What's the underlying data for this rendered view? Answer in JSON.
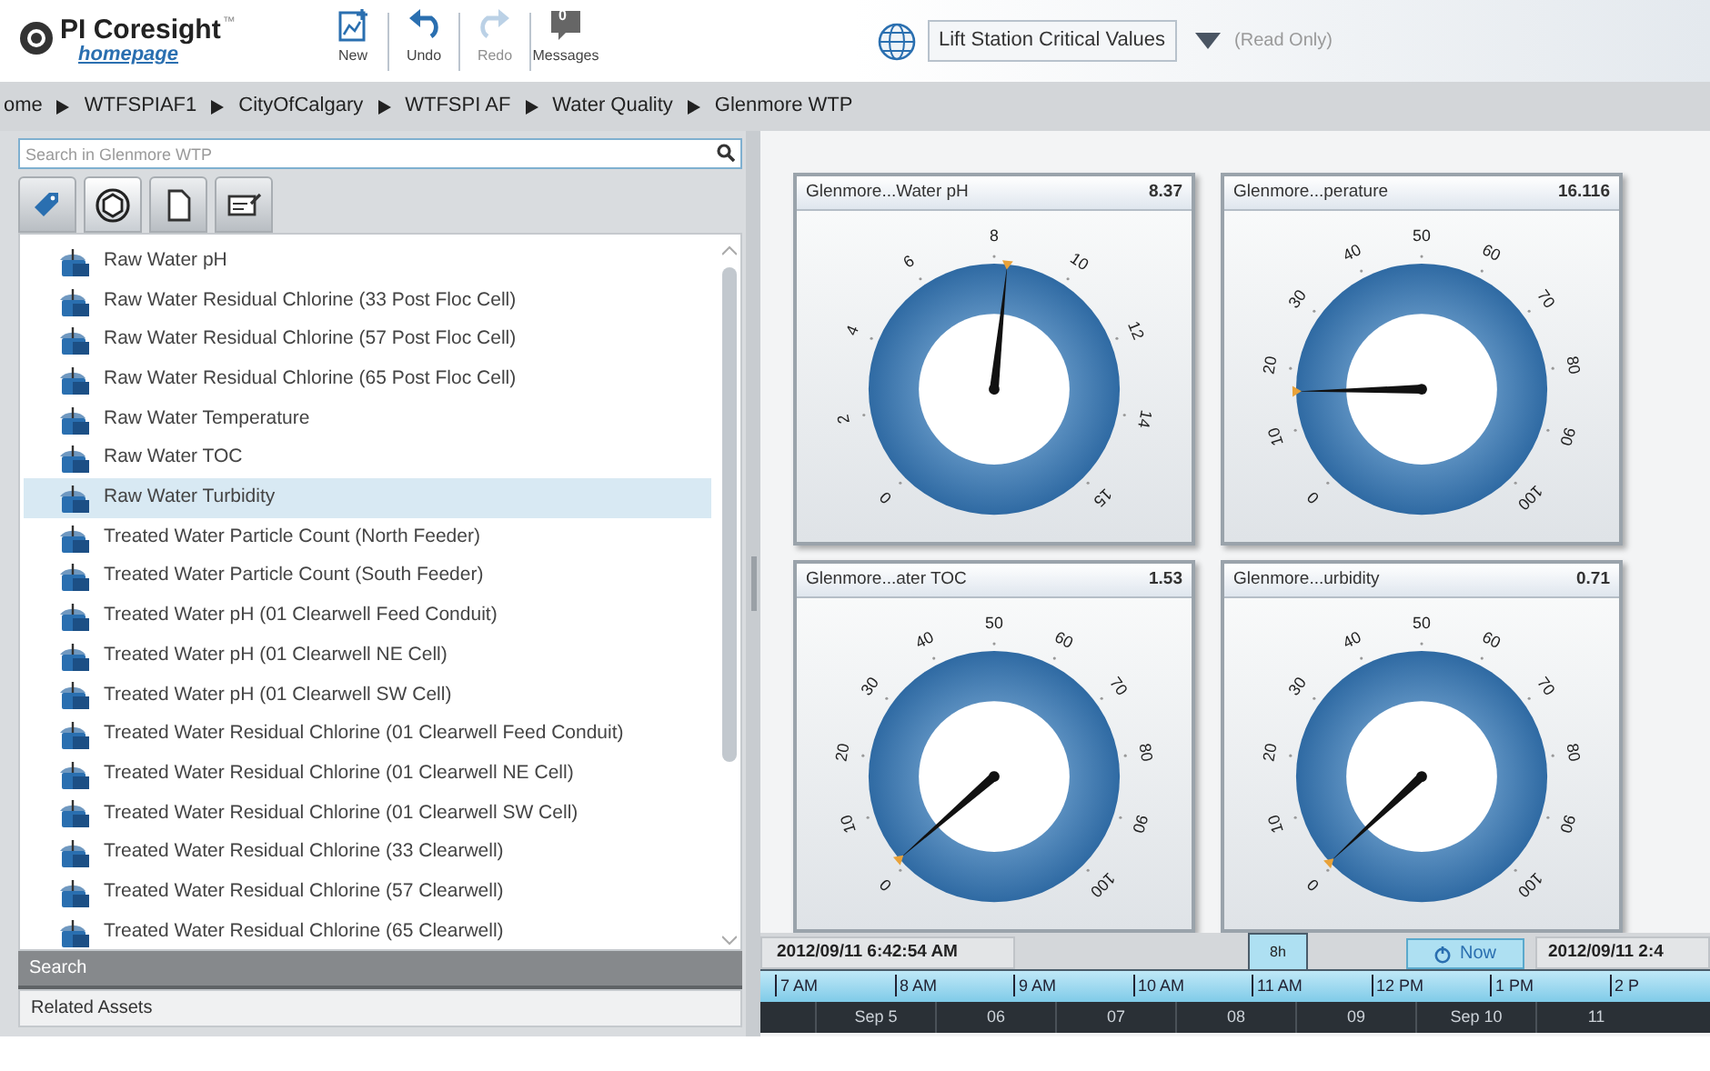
{
  "header": {
    "logo_title": "PI Coresight",
    "logo_tm": "™",
    "logo_subtitle": "homepage",
    "tools": [
      {
        "kind": "new",
        "label": "New",
        "disabled": false
      },
      {
        "kind": "undo",
        "label": "Undo",
        "disabled": false
      },
      {
        "kind": "redo",
        "label": "Redo",
        "disabled": true
      },
      {
        "kind": "messages",
        "label": "Messages",
        "disabled": false,
        "count": "0"
      }
    ],
    "display_name": "Lift Station Critical Values",
    "read_only": "(Read Only)"
  },
  "breadcrumb": [
    "ome",
    "WTFSPIAF1",
    "CityOfCalgary",
    "WTFSPI AF",
    "Water Quality",
    "Glenmore WTP"
  ],
  "search": {
    "placeholder": "Search in Glenmore WTP"
  },
  "filter_tabs": [
    {
      "kind": "tag",
      "selected": false
    },
    {
      "kind": "asset",
      "selected": true
    },
    {
      "kind": "document",
      "selected": false
    },
    {
      "kind": "form",
      "selected": false
    }
  ],
  "assets": [
    {
      "label": "Raw Water pH",
      "selected": false
    },
    {
      "label": "Raw Water Residual Chlorine (33 Post Floc Cell)",
      "selected": false
    },
    {
      "label": "Raw Water Residual Chlorine (57 Post Floc Cell)",
      "selected": false
    },
    {
      "label": "Raw Water Residual Chlorine (65 Post Floc Cell)",
      "selected": false
    },
    {
      "label": "Raw Water Temperature",
      "selected": false
    },
    {
      "label": "Raw Water TOC",
      "selected": false
    },
    {
      "label": "Raw Water Turbidity",
      "selected": true
    },
    {
      "label": "Treated Water Particle Count (North Feeder)",
      "selected": false
    },
    {
      "label": "Treated Water Particle Count (South Feeder)",
      "selected": false
    },
    {
      "label": "Treated Water pH (01 Clearwell Feed Conduit)",
      "selected": false
    },
    {
      "label": "Treated Water pH (01 Clearwell NE Cell)",
      "selected": false
    },
    {
      "label": "Treated Water pH (01 Clearwell SW Cell)",
      "selected": false
    },
    {
      "label": "Treated Water Residual Chlorine (01 Clearwell Feed Conduit)",
      "selected": false
    },
    {
      "label": "Treated Water Residual Chlorine (01 Clearwell NE Cell)",
      "selected": false
    },
    {
      "label": "Treated Water Residual Chlorine (01 Clearwell SW Cell)",
      "selected": false
    },
    {
      "label": "Treated Water Residual Chlorine (33 Clearwell)",
      "selected": false
    },
    {
      "label": "Treated Water Residual Chlorine (57 Clearwell)",
      "selected": false
    },
    {
      "label": "Treated Water Residual Chlorine (65 Clearwell)",
      "selected": false
    }
  ],
  "panels": [
    {
      "label": "Search",
      "selected": true
    },
    {
      "label": "Related Assets",
      "selected": false
    }
  ],
  "gauges": [
    {
      "title": "Glenmore...Water pH",
      "value": "8.37",
      "scale": [
        "0",
        "2",
        "4",
        "6",
        "8",
        "10",
        "12",
        "14",
        "15"
      ]
    },
    {
      "title": "Glenmore...perature",
      "value": "16.116",
      "scale": [
        "0",
        "10",
        "20",
        "30",
        "40",
        "50",
        "60",
        "70",
        "80",
        "90",
        "100"
      ]
    },
    {
      "title": "Glenmore...ater TOC",
      "value": "1.53",
      "scale": [
        "0",
        "10",
        "20",
        "30",
        "40",
        "50",
        "60",
        "70",
        "80",
        "90",
        "100"
      ]
    },
    {
      "title": "Glenmore...urbidity",
      "value": "0.71",
      "scale": [
        "0",
        "10",
        "20",
        "30",
        "40",
        "50",
        "60",
        "70",
        "80",
        "90",
        "100"
      ]
    }
  ],
  "timeline": {
    "start": "2012/09/11 6:42:54 AM",
    "duration": "8h",
    "now": "Now",
    "end": "2012/09/11 2:4",
    "hours": [
      "7 AM",
      "8 AM",
      "9 AM",
      "10 AM",
      "11 AM",
      "12 PM",
      "1 PM",
      "2 P"
    ],
    "days": [
      "Sep 5",
      "06",
      "07",
      "08",
      "09",
      "Sep 10",
      "11"
    ]
  }
}
